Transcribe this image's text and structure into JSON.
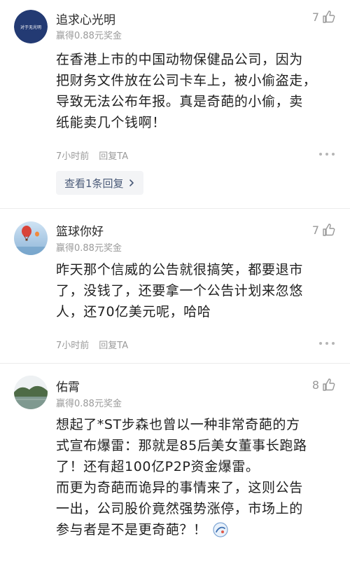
{
  "comments": [
    {
      "username": "追求心光明",
      "reward": "赢得0.88元奖金",
      "likes": "7",
      "avatar_icon": "user-avatar-text",
      "avatar_text": "对于无光明",
      "lines": [
        "在香港上市的中国动物保健品公司，因为",
        "把财务文件放在公司卡车上，被小偷盗走，",
        "导致无法公布年报。真是奇葩的小偷，卖",
        "纸能卖几个钱啊！"
      ],
      "time": "7小时前",
      "reply_label": "回复TA",
      "view_replies": "查看1条回复"
    },
    {
      "username": "篮球你好",
      "reward": "赢得0.88元奖金",
      "likes": "7",
      "avatar_icon": "hot-air-balloon-avatar",
      "lines": [
        "昨天那个信威的公告就很搞笑，都要退市",
        "了，没钱了，还要拿一个公告计划来忽悠",
        "人，还70亿美元呢，哈哈"
      ],
      "time": "7小时前",
      "reply_label": "回复TA"
    },
    {
      "username": "佑霄",
      "reward": "赢得0.88元奖金",
      "likes": "8",
      "avatar_icon": "landscape-avatar",
      "lines": [
        "想起了*ST步森也曾以一种非常奇葩的方",
        "式宣布爆雷：那就是85后美女董事长跑路",
        "了！还有超100亿P2P资金爆雷。",
        "而更为奇葩而诡异的事情来了，这则公告",
        "一出，公司股价竟然强势涨停，市场上的",
        "参与者是不是更奇葩？！"
      ]
    }
  ],
  "colors": {
    "text": "#1f1f1f",
    "muted": "#9b9b9b",
    "reply_link": "#4a5a78",
    "divider": "#ececec"
  }
}
